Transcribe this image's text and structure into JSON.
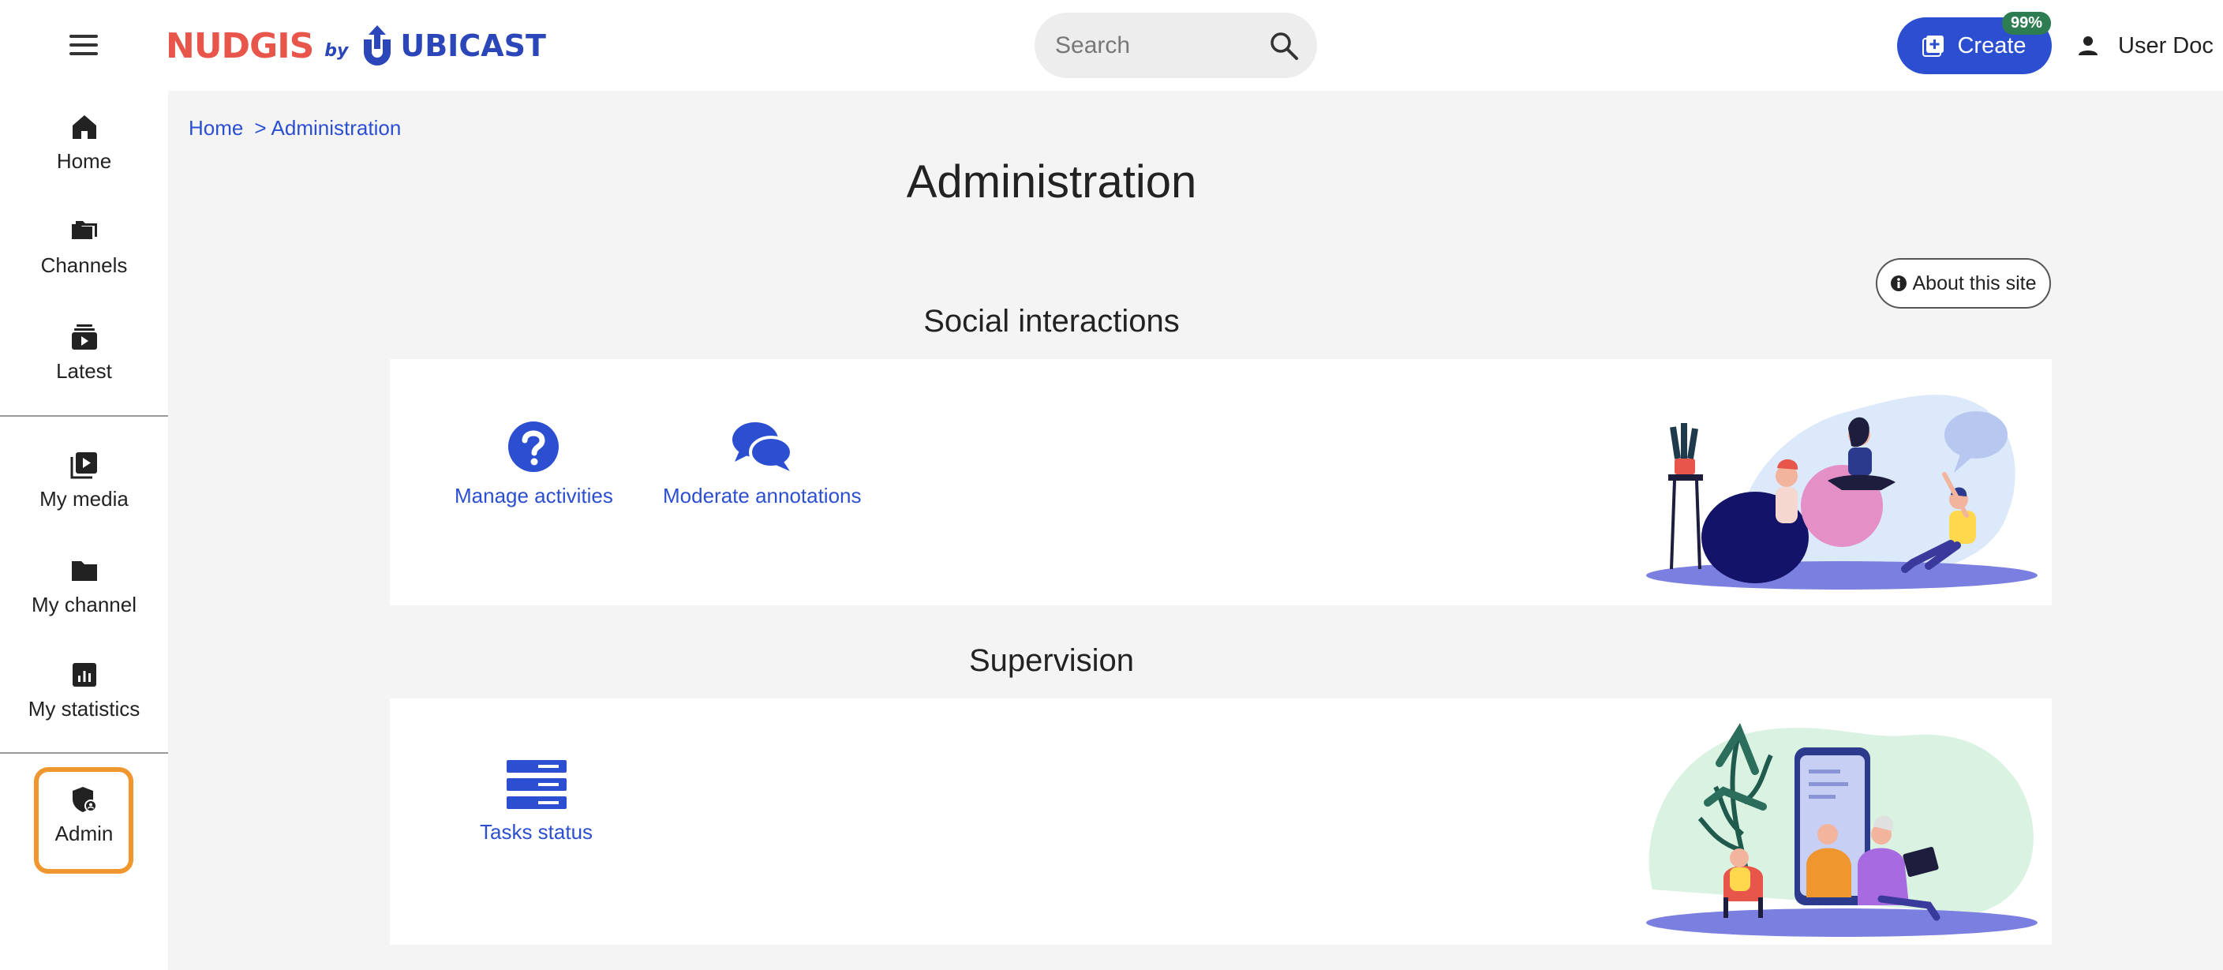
{
  "header": {
    "logo_text": "NUDGIS",
    "logo_by": "by",
    "logo_company": "UBICAST",
    "search_placeholder": "Search",
    "create_label": "Create",
    "quota_badge": "99%",
    "user_name": "User Doc"
  },
  "sidebar": {
    "items": [
      {
        "label": "Home",
        "icon": "home-icon"
      },
      {
        "label": "Channels",
        "icon": "channels-icon"
      },
      {
        "label": "Latest",
        "icon": "latest-icon"
      },
      {
        "label": "My media",
        "icon": "my-media-icon"
      },
      {
        "label": "My channel",
        "icon": "my-channel-icon"
      },
      {
        "label": "My statistics",
        "icon": "statistics-icon"
      },
      {
        "label": "Admin",
        "icon": "admin-shield-icon"
      }
    ]
  },
  "breadcrumb": {
    "home": "Home",
    "separator": ">",
    "current": "Administration"
  },
  "page": {
    "title": "Administration",
    "about_label": "About this site"
  },
  "sections": [
    {
      "title": "Social interactions",
      "tiles": [
        {
          "label": "Manage activities",
          "icon": "question-circle-icon"
        },
        {
          "label": "Moderate annotations",
          "icon": "comments-icon"
        }
      ]
    },
    {
      "title": "Supervision",
      "tiles": [
        {
          "label": "Tasks status",
          "icon": "server-icon"
        }
      ]
    }
  ],
  "colors": {
    "accent": "#2b4fd0",
    "logo_red": "#e8564b",
    "admin_highlight": "#f0962e",
    "badge_green": "#2e7d52",
    "main_background": "#f4f4f4"
  }
}
